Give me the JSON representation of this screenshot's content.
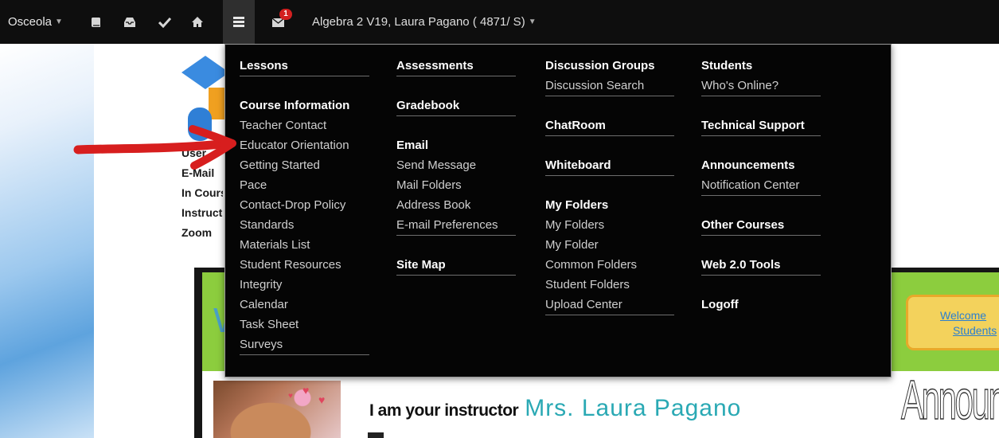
{
  "navbar": {
    "brand": "Osceola",
    "course": "Algebra 2 V19, Laura Pagano ( 4871/ S)",
    "messages_badge": "1",
    "icons": [
      "book-icon",
      "inbox-icon",
      "checkmark-icon",
      "home-icon",
      "menu-icon",
      "envelope-icon"
    ]
  },
  "menu": {
    "columns": [
      {
        "groups": [
          {
            "heading": "Lessons",
            "items": []
          },
          {
            "heading": "Course Information",
            "items": [
              "Teacher Contact",
              "Educator Orientation",
              "Getting Started",
              "Pace",
              "Contact-Drop Policy",
              "Standards",
              "Materials List",
              "Student Resources",
              "Integrity",
              "Calendar",
              "Task Sheet",
              "Surveys"
            ]
          }
        ]
      },
      {
        "groups": [
          {
            "heading": "Assessments",
            "items": []
          },
          {
            "heading": "Gradebook",
            "items": []
          },
          {
            "heading": "Email",
            "items": [
              "Send Message",
              "Mail Folders",
              "Address Book",
              "E-mail Preferences"
            ]
          },
          {
            "heading": "Site Map",
            "items": []
          }
        ]
      },
      {
        "groups": [
          {
            "heading": "Discussion Groups",
            "items": [
              "Discussion Search"
            ]
          },
          {
            "heading": "ChatRoom",
            "items": []
          },
          {
            "heading": "Whiteboard",
            "items": []
          },
          {
            "heading": "My Folders",
            "items": [
              "My Folders",
              "My Folder",
              "Common Folders",
              "Student Folders",
              "Upload Center"
            ]
          }
        ]
      },
      {
        "groups": [
          {
            "heading": "Students",
            "items": [
              "Who's Online?"
            ]
          },
          {
            "heading": "Technical Support",
            "items": []
          },
          {
            "heading": "Announcements",
            "items": [
              "Notification Center"
            ]
          },
          {
            "heading": "Other Courses",
            "items": []
          },
          {
            "heading": "Web 2.0 Tools",
            "items": []
          },
          {
            "heading": "Logoff",
            "items": []
          }
        ]
      }
    ]
  },
  "course_info": [
    "User",
    "E-Mail",
    "In Course",
    "Instructor",
    "Zoom"
  ],
  "page": {
    "intro_text": "I am your instructor",
    "instructor_name": "Mrs. Laura Pagano",
    "welcome_line1": "Welcome",
    "welcome_line2": "Students",
    "announcements": "Announ",
    "frame_letter": "W"
  },
  "colors": {
    "navbar_bg": "#0e0e0e",
    "menu_bg": "#050505",
    "annotation_arrow": "#d71e1e",
    "frame_green": "#8ccd3e",
    "instructor_name": "#2aa9b4"
  }
}
